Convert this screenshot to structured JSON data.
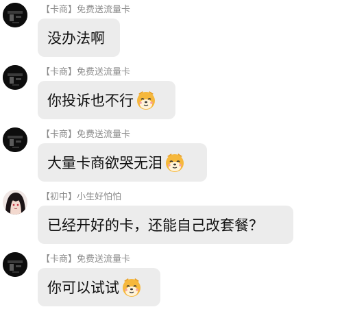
{
  "messages": [
    {
      "sender": "【卡商】免费送流量卡",
      "text": "没办法啊",
      "emoji": "",
      "avatar_icon": "dark-avatar-icon"
    },
    {
      "sender": "【卡商】免费送流量卡",
      "text": "你投诉也不行",
      "emoji": "dog-face-emoji",
      "avatar_icon": "dark-avatar-icon"
    },
    {
      "sender": "【卡商】免费送流量卡",
      "text": "大量卡商欲哭无泪",
      "emoji": "dog-face-emoji",
      "avatar_icon": "dark-avatar-icon"
    },
    {
      "sender": "【初中】小生好怕怕",
      "text": "已经开好的卡，还能自己改套餐？",
      "emoji": "",
      "avatar_icon": "anime-avatar-icon"
    },
    {
      "sender": "【卡商】免费送流量卡",
      "text": "你可以试试",
      "emoji": "dog-face-emoji",
      "avatar_icon": "dark-avatar-icon"
    }
  ],
  "colors": {
    "bubble_bg": "#ececec",
    "sender_text": "#8a8a8a",
    "message_text": "#111111",
    "emoji_fur": "#f6b83c"
  }
}
